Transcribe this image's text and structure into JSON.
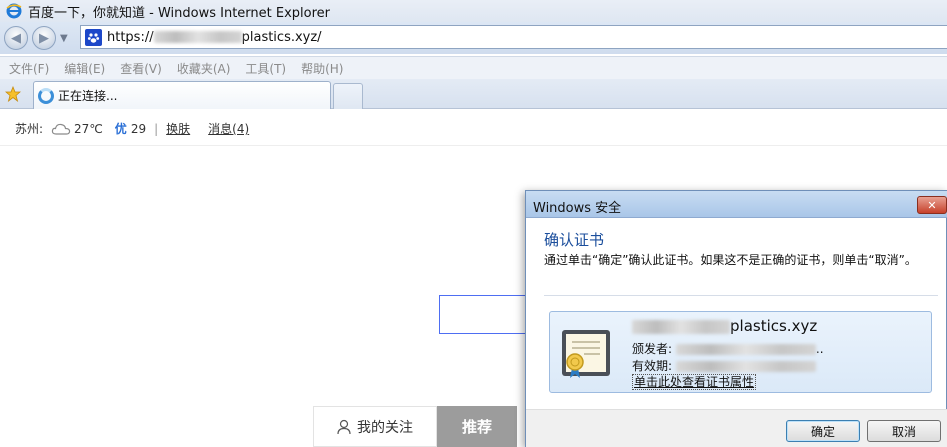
{
  "window": {
    "title": "百度一下，你就知道 - Windows Internet Explorer"
  },
  "address_bar": {
    "prefix": "https://",
    "suffix": "plastics.xyz/"
  },
  "menu": [
    "文件(F)",
    "编辑(E)",
    "查看(V)",
    "收藏夹(A)",
    "工具(T)",
    "帮助(H)"
  ],
  "tabs": {
    "active_label": "正在连接..."
  },
  "page": {
    "city": "苏州:",
    "temperature": "27℃",
    "aqi_label": "优",
    "aqi_value": "29",
    "separator": "|",
    "skin_link": "换肤",
    "messages_link": "消息(4)",
    "follow_tab": "我的关注",
    "recommend_tab": "推荐"
  },
  "dialog": {
    "title": "Windows 安全",
    "close_symbol": "✕",
    "heading": "确认证书",
    "message": "通过单击“确定”确认此证书。如果这不是正确的证书，则单击“取消”。",
    "cert_domain_suffix": "plastics.xyz",
    "issuer_label": "颁发者:",
    "issuer_suffix": "..",
    "valid_label": "有效期:",
    "cert_link": "单击此处查看证书属性",
    "ok_label": "确定",
    "cancel_label": "取消"
  },
  "colors": {
    "dialog_heading": "#1b4e9c",
    "aqi": "#2a6fd6",
    "recommend_bg": "#9c9c9c"
  }
}
